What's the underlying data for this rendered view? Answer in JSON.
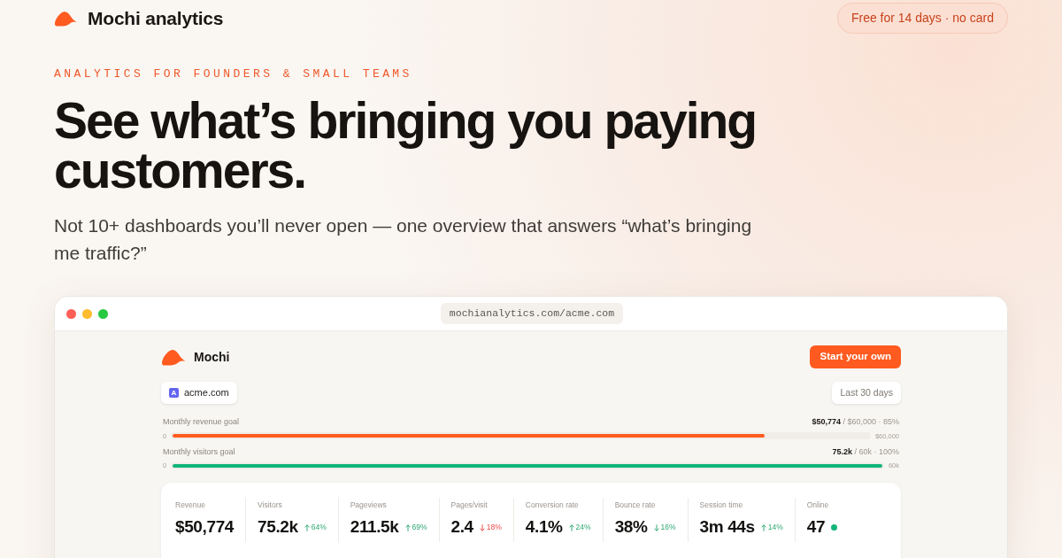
{
  "header": {
    "brand": "Mochi analytics",
    "badge": "Free for 14 days · no card"
  },
  "hero": {
    "eyebrow": "ANALYTICS FOR FOUNDERS & SMALL TEAMS",
    "headline": "See what’s bringing you paying customers.",
    "subheadline": "Not 10+ dashboards you’ll never open — one overview that answers “what’s bringing me traffic?”"
  },
  "browser": {
    "url": "mochianalytics.com/acme.com"
  },
  "dashboard": {
    "brand": "Mochi",
    "cta": "Start your own",
    "site": {
      "initial": "A",
      "name": "acme.com"
    },
    "date_range": "Last 30 days",
    "goals": [
      {
        "label": "Monthly revenue goal",
        "progress": "**$50,774** / $60,000 · 85%",
        "start": "0",
        "target": "$60,000",
        "level": 0.85,
        "color": "#ff5a1f"
      },
      {
        "label": "Monthly visitors goal",
        "progress": "**75.2k** / 60k · 100%",
        "start": "0",
        "target": "60k",
        "level": 1,
        "color": "#12b47a"
      }
    ],
    "stats": [
      {
        "label": "Revenue",
        "value": "$50,774"
      },
      {
        "label": "Visitors",
        "value": "75.2k",
        "change": {
          "text": "64%",
          "rising": true,
          "favorable": true
        }
      },
      {
        "label": "Pageviews",
        "value": "211.5k",
        "change": {
          "text": "69%",
          "rising": true,
          "favorable": true
        }
      },
      {
        "label": "Pages/visit",
        "value": "2.4",
        "change": {
          "text": "18%",
          "rising": false,
          "favorable": false
        }
      },
      {
        "label": "Conversion rate",
        "value": "4.1%",
        "change": {
          "text": "24%",
          "rising": true,
          "favorable": true
        }
      },
      {
        "label": "Bounce rate",
        "value": "38%",
        "change": {
          "text": "16%",
          "rising": false,
          "favorable": true
        }
      },
      {
        "label": "Session time",
        "value": "3m 44s",
        "change": {
          "text": "14%",
          "rising": true,
          "favorable": true
        }
      },
      {
        "label": "Online",
        "value": "47",
        "live": true
      }
    ]
  }
}
